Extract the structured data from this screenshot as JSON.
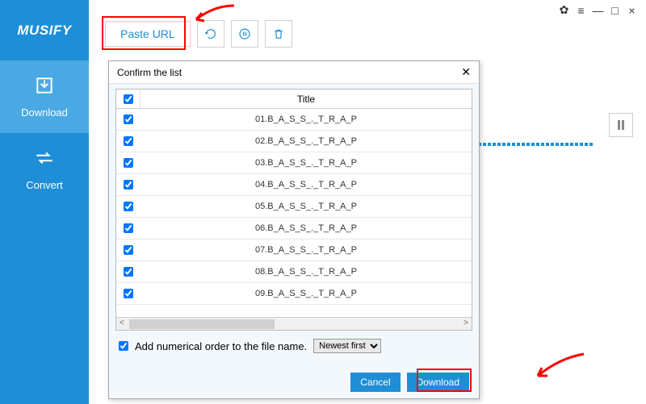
{
  "app": {
    "name": "MUSIFY"
  },
  "sidebar": {
    "items": [
      {
        "label": "Download",
        "icon": "download"
      },
      {
        "label": "Convert",
        "icon": "convert"
      }
    ]
  },
  "toolbar": {
    "paste_label": "Paste URL"
  },
  "dialog": {
    "title": "Confirm the list",
    "header_title": "Title",
    "rows": [
      {
        "title": "01.B_A_S_S_._T_R_A_P"
      },
      {
        "title": "02.B_A_S_S_._T_R_A_P"
      },
      {
        "title": "03.B_A_S_S_._T_R_A_P"
      },
      {
        "title": "04.B_A_S_S_._T_R_A_P"
      },
      {
        "title": "05.B_A_S_S_._T_R_A_P"
      },
      {
        "title": "06.B_A_S_S_._T_R_A_P"
      },
      {
        "title": "07.B_A_S_S_._T_R_A_P"
      },
      {
        "title": "08.B_A_S_S_._T_R_A_P"
      },
      {
        "title": "09.B_A_S_S_._T_R_A_P"
      }
    ],
    "add_numerical_label": "Add numerical order to the file name.",
    "sort_selected": "Newest first",
    "cancel_label": "Cancel",
    "download_label": "Download"
  }
}
